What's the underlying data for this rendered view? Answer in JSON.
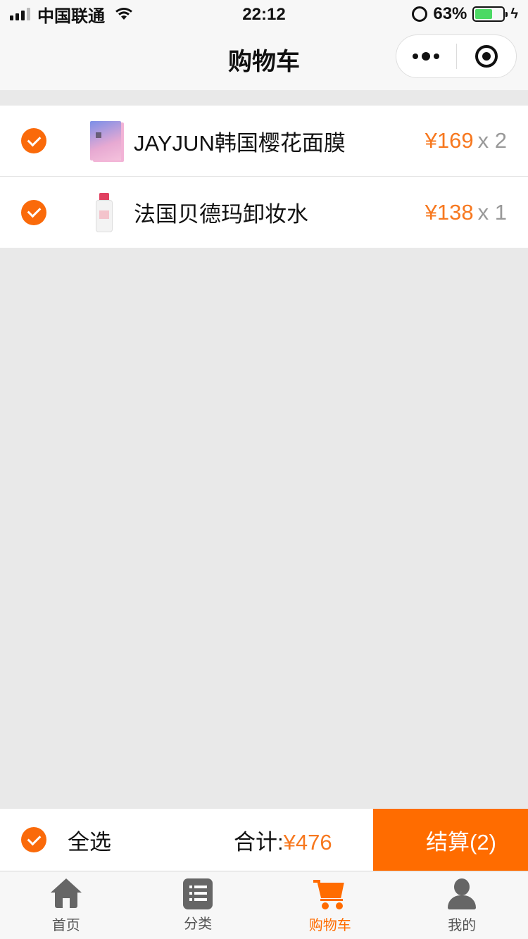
{
  "status_bar": {
    "carrier": "中国联通",
    "time": "22:12",
    "battery": "63%",
    "battery_level": 0.63
  },
  "nav": {
    "title": "购物车"
  },
  "cart": {
    "items": [
      {
        "name": "JAYJUN韩国樱花面膜",
        "price": "¥169",
        "qty": "x 2",
        "checked": true
      },
      {
        "name": "法国贝德玛卸妆水",
        "price": "¥138",
        "qty": "x 1",
        "checked": true
      }
    ]
  },
  "summary": {
    "select_all_label": "全选",
    "total_label": "合计:",
    "total_value": "¥476",
    "checkout_label": "结算(2)"
  },
  "tabs": [
    {
      "label": "首页",
      "icon": "home-icon",
      "active": false
    },
    {
      "label": "分类",
      "icon": "category-icon",
      "active": false
    },
    {
      "label": "购物车",
      "icon": "cart-icon",
      "active": true
    },
    {
      "label": "我的",
      "icon": "user-icon",
      "active": false
    }
  ],
  "colors": {
    "accent": "#ff6c00",
    "price": "#f7781f",
    "background": "#e9e9e9"
  }
}
